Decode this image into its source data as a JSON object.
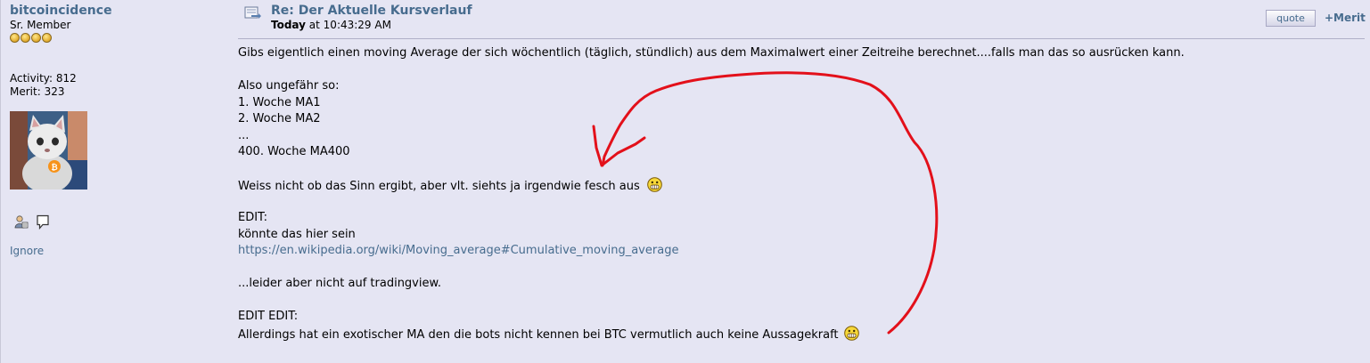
{
  "poster": {
    "name": "bitcoincidence",
    "rank": "Sr. Member",
    "stars": 4,
    "activity": "Activity: 812",
    "merit": "Merit: 323",
    "ignore": "Ignore"
  },
  "header": {
    "subject": "Re: Der Aktuelle Kursverlauf",
    "date_day": "Today",
    "date_time": " at 10:43:29 AM",
    "quote_label": "quote",
    "merit_label": "+Merit"
  },
  "body": {
    "l1": "Gibs eigentlich einen moving Average der sich wöchentlich (täglich, stündlich) aus dem Maximalwert einer Zeitreihe berechnet....falls man das so ausrücken kann.",
    "l2": "Also ungefähr so:",
    "l3": "1. Woche MA1",
    "l4": "2. Woche MA2",
    "l5": "...",
    "l6": "400. Woche MA400",
    "l7": "Weiss nicht ob das Sinn ergibt, aber vlt. siehts ja irgendwie fesch aus",
    "l8": "EDIT:",
    "l9": "könnte das hier sein",
    "link": "https://en.wikipedia.org/wiki/Moving_average#Cumulative_moving_average",
    "l10": "...leider aber nicht auf tradingview.",
    "l11": "EDIT EDIT:",
    "l12": "Allerdings hat ein exotischer MA den die bots nicht kennen bei BTC vermutlich auch keine Aussagekraft"
  },
  "colors": {
    "background": "#e5e5f3",
    "link": "#476c8e",
    "annotation": "#e3101a"
  },
  "icons": [
    "star-icon",
    "post-icon",
    "profile-icon",
    "message-icon",
    "grin-smiley-icon",
    "bitcoin-badge-icon"
  ]
}
